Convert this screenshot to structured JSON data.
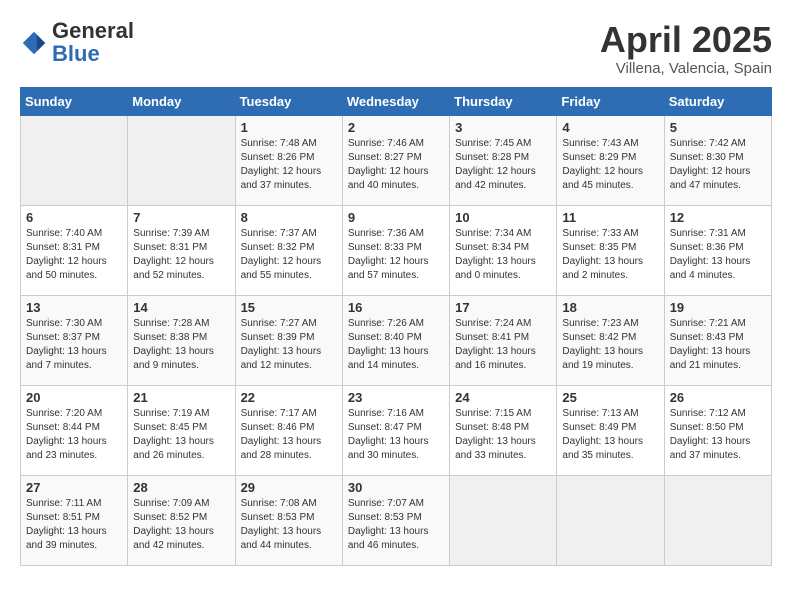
{
  "header": {
    "logo_general": "General",
    "logo_blue": "Blue",
    "title": "April 2025",
    "subtitle": "Villena, Valencia, Spain"
  },
  "days_of_week": [
    "Sunday",
    "Monday",
    "Tuesday",
    "Wednesday",
    "Thursday",
    "Friday",
    "Saturday"
  ],
  "weeks": [
    [
      {
        "day": "",
        "info": ""
      },
      {
        "day": "",
        "info": ""
      },
      {
        "day": "1",
        "info": "Sunrise: 7:48 AM\nSunset: 8:26 PM\nDaylight: 12 hours and 37 minutes."
      },
      {
        "day": "2",
        "info": "Sunrise: 7:46 AM\nSunset: 8:27 PM\nDaylight: 12 hours and 40 minutes."
      },
      {
        "day": "3",
        "info": "Sunrise: 7:45 AM\nSunset: 8:28 PM\nDaylight: 12 hours and 42 minutes."
      },
      {
        "day": "4",
        "info": "Sunrise: 7:43 AM\nSunset: 8:29 PM\nDaylight: 12 hours and 45 minutes."
      },
      {
        "day": "5",
        "info": "Sunrise: 7:42 AM\nSunset: 8:30 PM\nDaylight: 12 hours and 47 minutes."
      }
    ],
    [
      {
        "day": "6",
        "info": "Sunrise: 7:40 AM\nSunset: 8:31 PM\nDaylight: 12 hours and 50 minutes."
      },
      {
        "day": "7",
        "info": "Sunrise: 7:39 AM\nSunset: 8:31 PM\nDaylight: 12 hours and 52 minutes."
      },
      {
        "day": "8",
        "info": "Sunrise: 7:37 AM\nSunset: 8:32 PM\nDaylight: 12 hours and 55 minutes."
      },
      {
        "day": "9",
        "info": "Sunrise: 7:36 AM\nSunset: 8:33 PM\nDaylight: 12 hours and 57 minutes."
      },
      {
        "day": "10",
        "info": "Sunrise: 7:34 AM\nSunset: 8:34 PM\nDaylight: 13 hours and 0 minutes."
      },
      {
        "day": "11",
        "info": "Sunrise: 7:33 AM\nSunset: 8:35 PM\nDaylight: 13 hours and 2 minutes."
      },
      {
        "day": "12",
        "info": "Sunrise: 7:31 AM\nSunset: 8:36 PM\nDaylight: 13 hours and 4 minutes."
      }
    ],
    [
      {
        "day": "13",
        "info": "Sunrise: 7:30 AM\nSunset: 8:37 PM\nDaylight: 13 hours and 7 minutes."
      },
      {
        "day": "14",
        "info": "Sunrise: 7:28 AM\nSunset: 8:38 PM\nDaylight: 13 hours and 9 minutes."
      },
      {
        "day": "15",
        "info": "Sunrise: 7:27 AM\nSunset: 8:39 PM\nDaylight: 13 hours and 12 minutes."
      },
      {
        "day": "16",
        "info": "Sunrise: 7:26 AM\nSunset: 8:40 PM\nDaylight: 13 hours and 14 minutes."
      },
      {
        "day": "17",
        "info": "Sunrise: 7:24 AM\nSunset: 8:41 PM\nDaylight: 13 hours and 16 minutes."
      },
      {
        "day": "18",
        "info": "Sunrise: 7:23 AM\nSunset: 8:42 PM\nDaylight: 13 hours and 19 minutes."
      },
      {
        "day": "19",
        "info": "Sunrise: 7:21 AM\nSunset: 8:43 PM\nDaylight: 13 hours and 21 minutes."
      }
    ],
    [
      {
        "day": "20",
        "info": "Sunrise: 7:20 AM\nSunset: 8:44 PM\nDaylight: 13 hours and 23 minutes."
      },
      {
        "day": "21",
        "info": "Sunrise: 7:19 AM\nSunset: 8:45 PM\nDaylight: 13 hours and 26 minutes."
      },
      {
        "day": "22",
        "info": "Sunrise: 7:17 AM\nSunset: 8:46 PM\nDaylight: 13 hours and 28 minutes."
      },
      {
        "day": "23",
        "info": "Sunrise: 7:16 AM\nSunset: 8:47 PM\nDaylight: 13 hours and 30 minutes."
      },
      {
        "day": "24",
        "info": "Sunrise: 7:15 AM\nSunset: 8:48 PM\nDaylight: 13 hours and 33 minutes."
      },
      {
        "day": "25",
        "info": "Sunrise: 7:13 AM\nSunset: 8:49 PM\nDaylight: 13 hours and 35 minutes."
      },
      {
        "day": "26",
        "info": "Sunrise: 7:12 AM\nSunset: 8:50 PM\nDaylight: 13 hours and 37 minutes."
      }
    ],
    [
      {
        "day": "27",
        "info": "Sunrise: 7:11 AM\nSunset: 8:51 PM\nDaylight: 13 hours and 39 minutes."
      },
      {
        "day": "28",
        "info": "Sunrise: 7:09 AM\nSunset: 8:52 PM\nDaylight: 13 hours and 42 minutes."
      },
      {
        "day": "29",
        "info": "Sunrise: 7:08 AM\nSunset: 8:53 PM\nDaylight: 13 hours and 44 minutes."
      },
      {
        "day": "30",
        "info": "Sunrise: 7:07 AM\nSunset: 8:53 PM\nDaylight: 13 hours and 46 minutes."
      },
      {
        "day": "",
        "info": ""
      },
      {
        "day": "",
        "info": ""
      },
      {
        "day": "",
        "info": ""
      }
    ]
  ]
}
